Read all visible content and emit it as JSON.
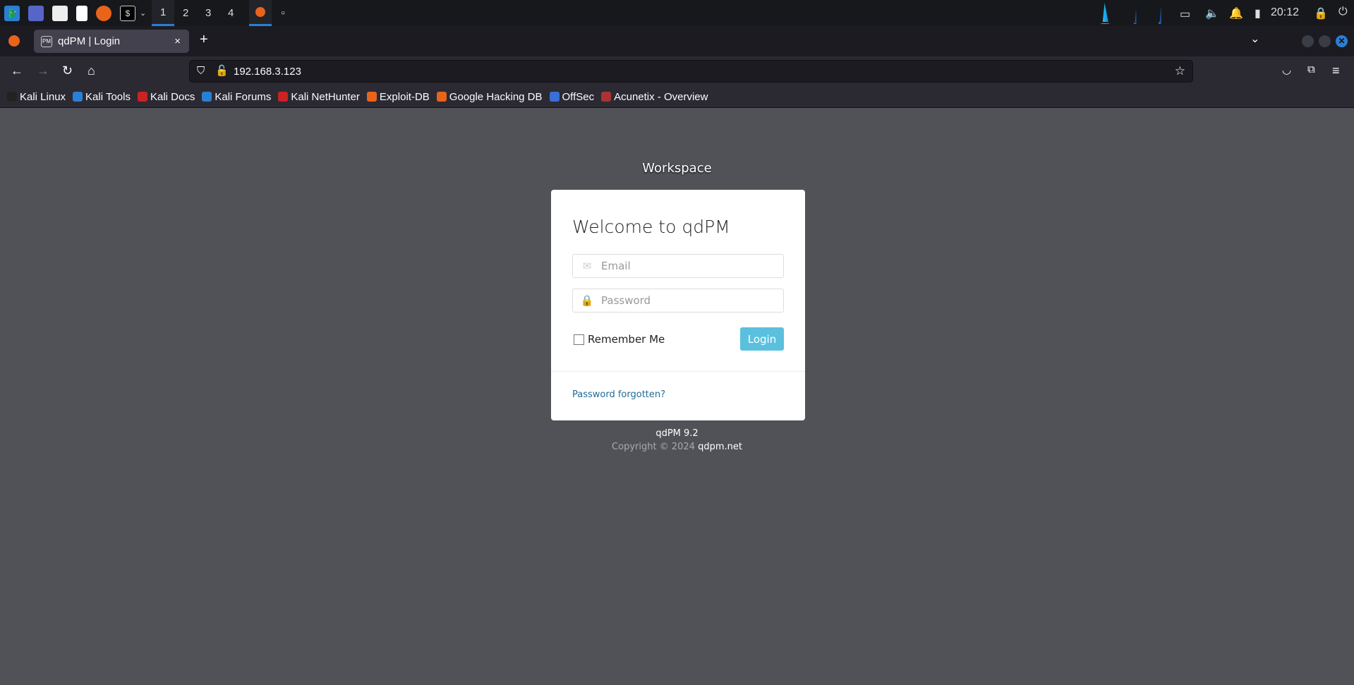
{
  "taskbar": {
    "workspaces": [
      "1",
      "2",
      "3",
      "4"
    ],
    "clock": "20:12"
  },
  "browser": {
    "tab_title": "qdPM | Login",
    "tab_close": "×",
    "new_tab": "+",
    "url": "192.168.3.123",
    "bookmarks": [
      {
        "label": "Kali Linux",
        "color": "#222"
      },
      {
        "label": "Kali Tools",
        "color": "#2a7fd4"
      },
      {
        "label": "Kali Docs",
        "color": "#c22"
      },
      {
        "label": "Kali Forums",
        "color": "#2a7fd4"
      },
      {
        "label": "Kali NetHunter",
        "color": "#c22"
      },
      {
        "label": "Exploit-DB",
        "color": "#e8641b"
      },
      {
        "label": "Google Hacking DB",
        "color": "#e8641b"
      },
      {
        "label": "OffSec",
        "color": "#3a6fd8"
      },
      {
        "label": "Acunetix - Overview",
        "color": "#a33"
      }
    ]
  },
  "page": {
    "workspace": "Workspace",
    "heading": "Welcome to qdPM",
    "email_placeholder": "Email",
    "password_placeholder": "Password",
    "remember": "Remember Me",
    "login": "Login",
    "forgot": "Password forgotten?",
    "version": "qdPM 9.2",
    "copyright": "Copyright © 2024",
    "site": "qdpm.net",
    "accent": "#5bc0de"
  }
}
